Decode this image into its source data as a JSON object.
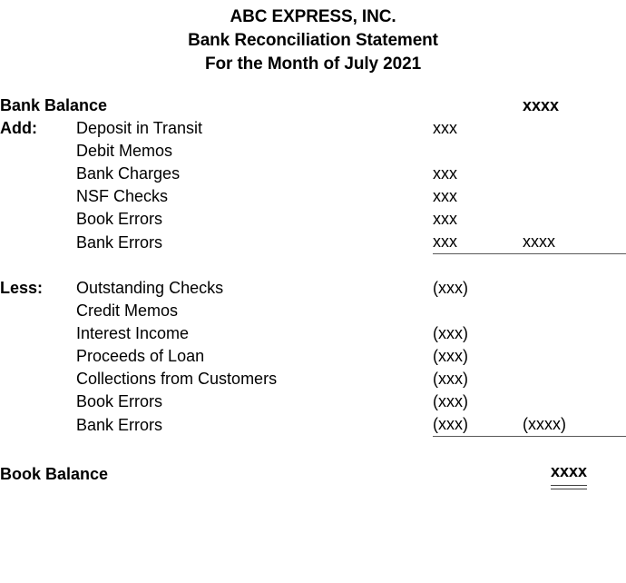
{
  "document": {
    "title_lines": [
      "ABC EXPRESS, INC.",
      "Bank Reconciliation Statement",
      "For the Month of July 2021"
    ]
  },
  "colors": {
    "text": "#000000",
    "rule": "#595959",
    "background": "#ffffff"
  },
  "statement": {
    "opening": {
      "label": "Bank Balance",
      "amount": "xxxx"
    },
    "add_section": {
      "section_label": "Add:",
      "rows": [
        {
          "label": "Deposit in Transit",
          "indent": 1,
          "amount1": "xxx",
          "amount2": ""
        },
        {
          "label": "Debit Memos",
          "indent": 1,
          "amount1": "",
          "amount2": ""
        },
        {
          "label": "Bank Charges",
          "indent": 2,
          "amount1": "xxx",
          "amount2": ""
        },
        {
          "label": "NSF Checks",
          "indent": 2,
          "amount1": "xxx",
          "amount2": ""
        },
        {
          "label": "Book Errors",
          "indent": 1,
          "amount1": "xxx",
          "amount2": ""
        },
        {
          "label": "Bank Errors",
          "indent": 1,
          "amount1": "xxx",
          "amount2": "xxxx"
        }
      ]
    },
    "less_section": {
      "section_label": "Less:",
      "rows": [
        {
          "label": "Outstanding Checks",
          "indent": 1,
          "amount1": "(xxx)",
          "amount2": ""
        },
        {
          "label": "Credit Memos",
          "indent": 1,
          "amount1": "",
          "amount2": ""
        },
        {
          "label": "Interest Income",
          "indent": 2,
          "amount1": "(xxx)",
          "amount2": ""
        },
        {
          "label": "Proceeds of Loan",
          "indent": 2,
          "amount1": "(xxx)",
          "amount2": ""
        },
        {
          "label": "Collections from Customers",
          "indent": 2,
          "amount1": "(xxx)",
          "amount2": ""
        },
        {
          "label": "Book Errors",
          "indent": 1,
          "amount1": "(xxx)",
          "amount2": ""
        },
        {
          "label": "Bank Errors",
          "indent": 1,
          "amount1": "(xxx)",
          "amount2": "(xxxx)"
        }
      ]
    },
    "closing": {
      "label": "Book Balance",
      "amount": "xxxx"
    }
  }
}
